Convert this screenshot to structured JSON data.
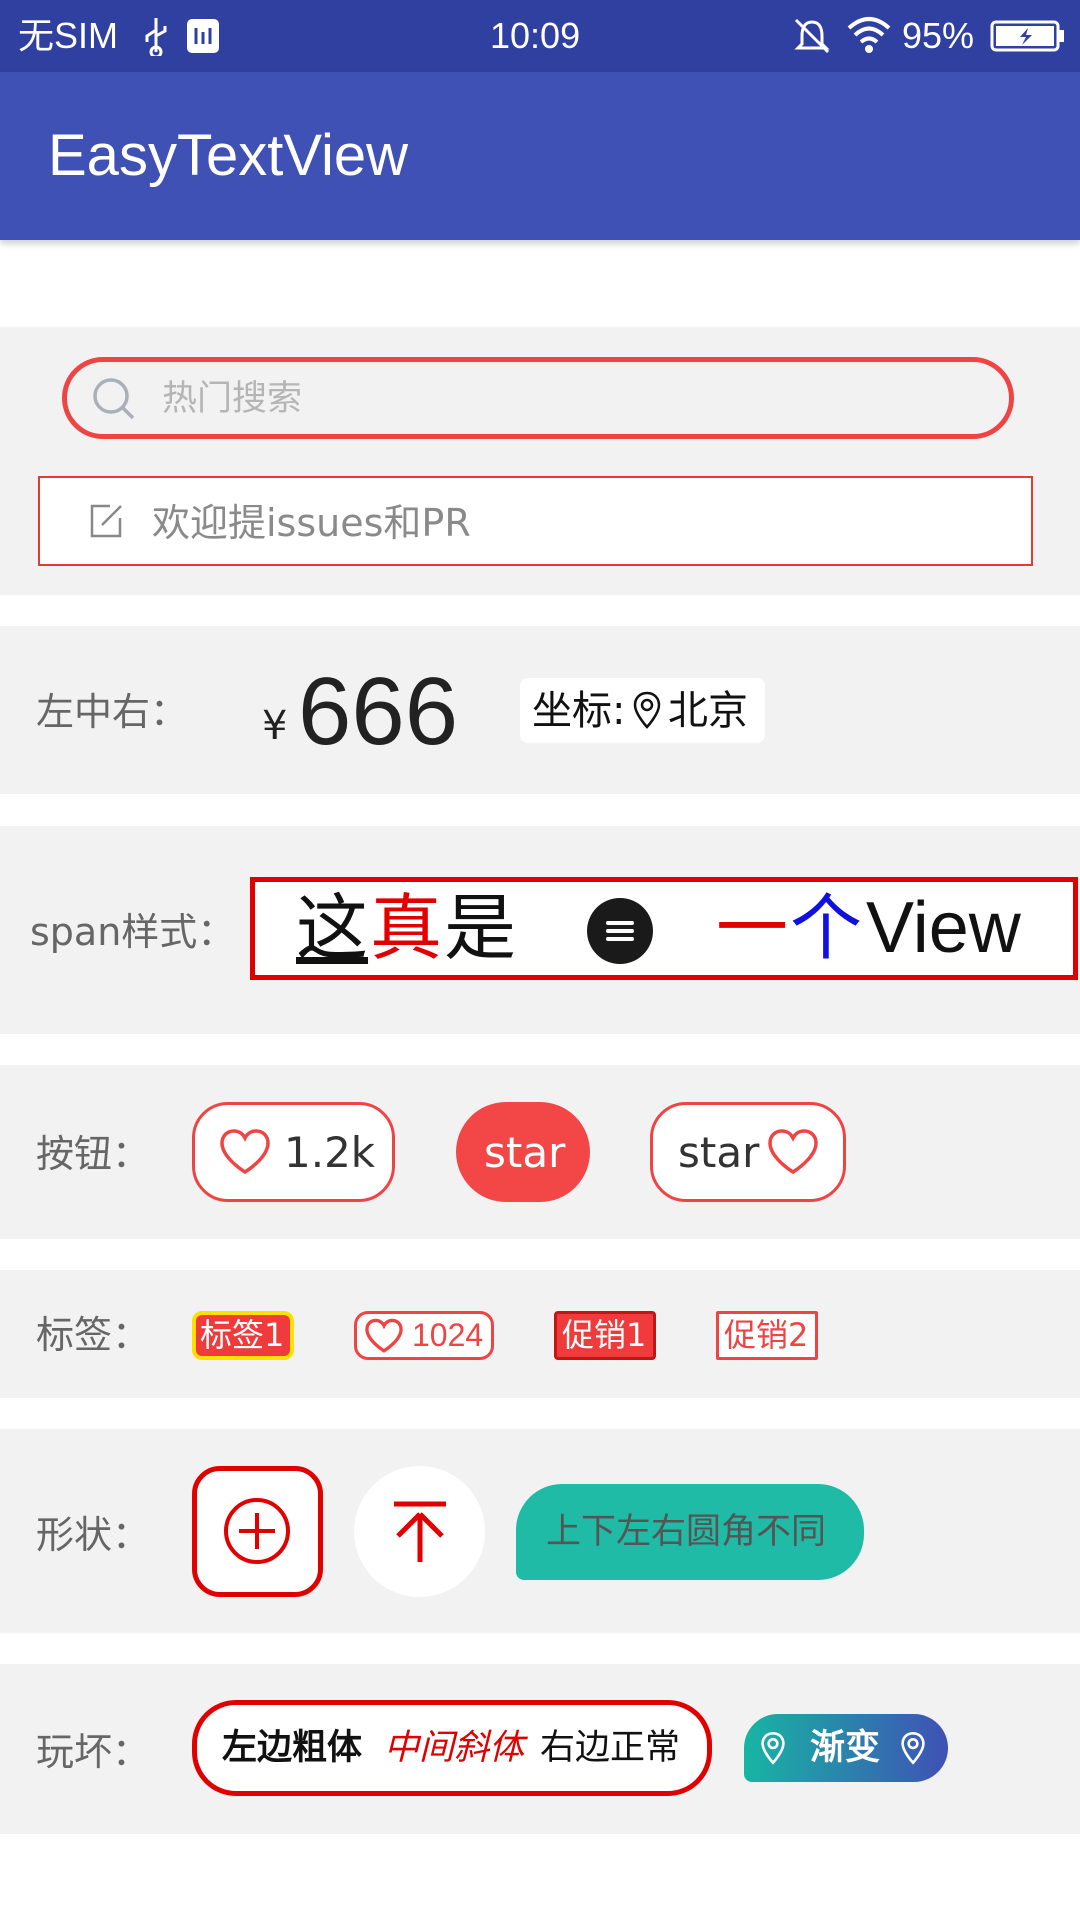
{
  "status_bar": {
    "carrier": "无SIM",
    "time": "10:09",
    "battery": "95%",
    "icons": [
      "usb-icon",
      "debug-icon",
      "mute-icon",
      "wifi-icon",
      "battery-icon"
    ]
  },
  "app_bar": {
    "title": "EasyTextView"
  },
  "search": {
    "placeholder": "热门搜索"
  },
  "input": {
    "placeholder": "欢迎提issues和PR"
  },
  "row_center": {
    "label": "左中右：",
    "currency": "¥",
    "price": "666",
    "coord_prefix": "坐标:",
    "coord_city": "北京"
  },
  "row_span": {
    "label": "span样式：",
    "part1": "这",
    "part2": "真",
    "part3": "是",
    "part4": "一",
    "part5": "个",
    "part6": "View",
    "colors": {
      "red": "#e00000",
      "blue": "#1010e0",
      "black": "#111111"
    }
  },
  "row_buttons": {
    "label": "按钮：",
    "like_count": "1.2k",
    "star_filled": "star",
    "star_outline": "star"
  },
  "row_tags": {
    "label": "标签：",
    "tag1": "标签1",
    "tag2": "1024",
    "tag3": "促销1",
    "tag4": "促销2"
  },
  "row_shapes": {
    "label": "形状：",
    "rounded_corner": "上下左右圆角不同"
  },
  "row_play": {
    "label": "玩坏：",
    "bold_part": "左边粗体",
    "italic_part": "中间斜体",
    "normal_part": "右边正常",
    "gradient": "渐变"
  },
  "colors": {
    "primary": "#3f51b5",
    "status_bar": "#3040a0",
    "accent_red": "#ef4444",
    "teal": "#1fbba6"
  }
}
